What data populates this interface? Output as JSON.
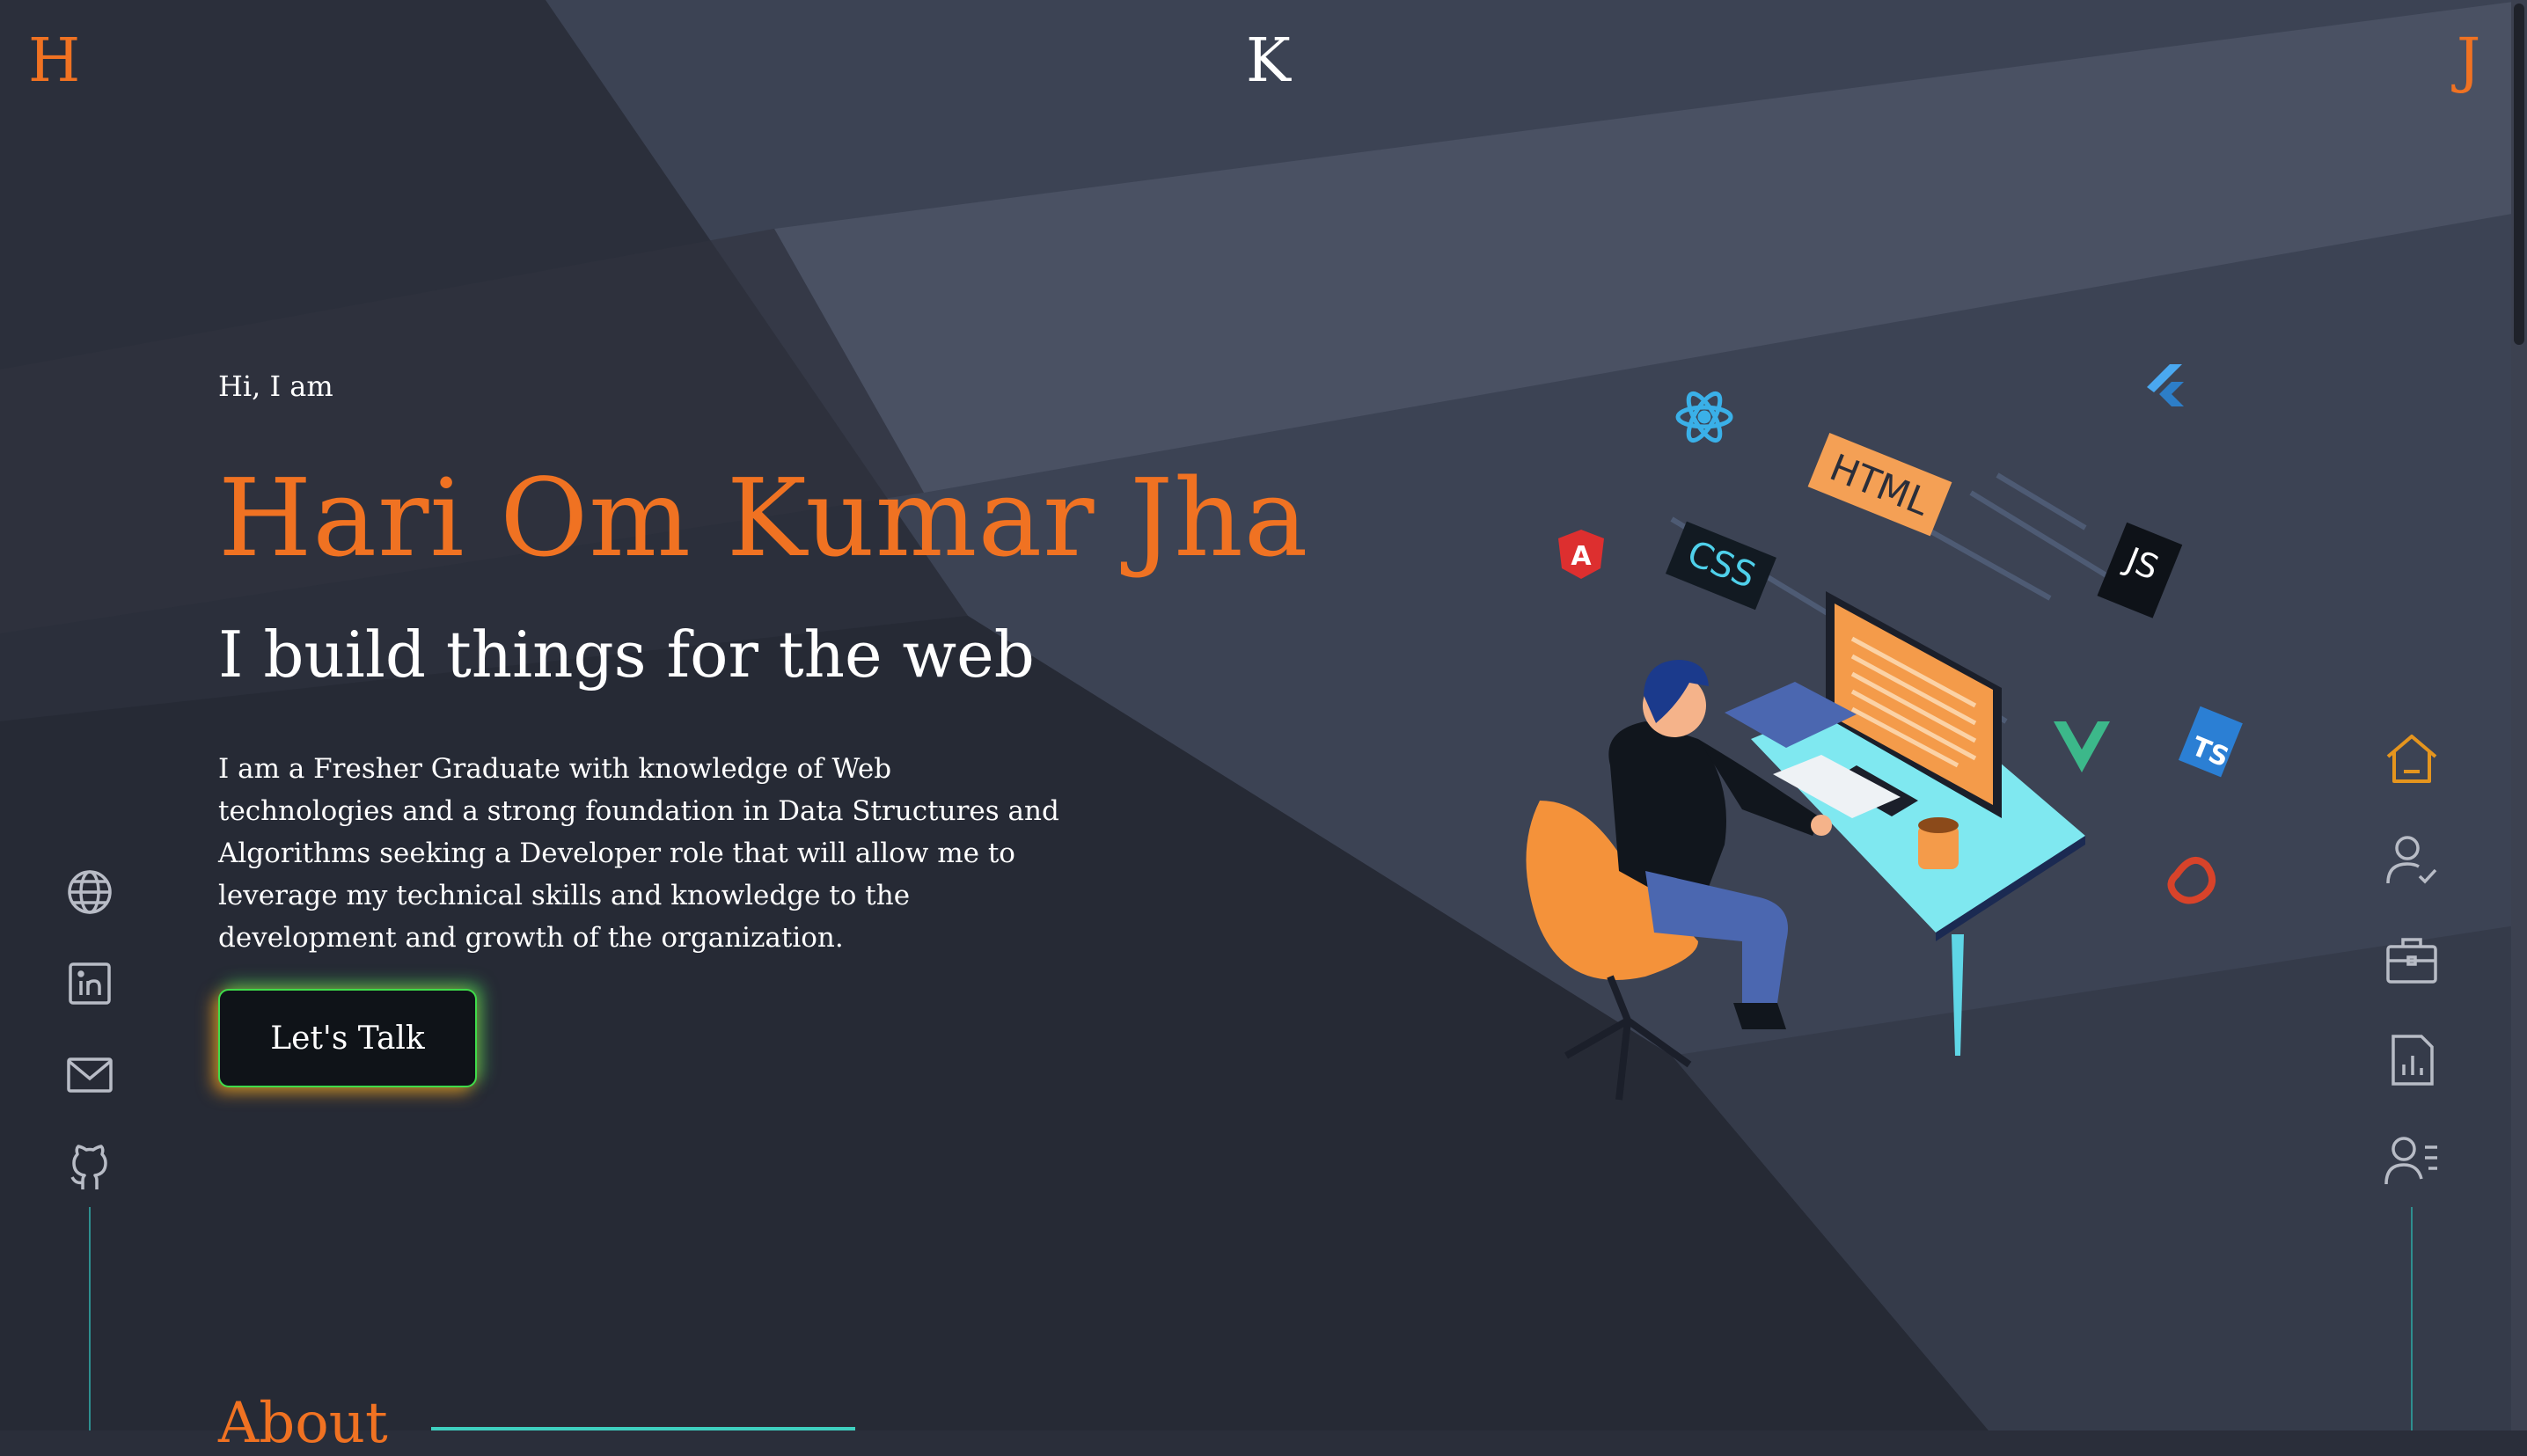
{
  "header": {
    "left_logo": "H",
    "center_logo": "K",
    "right_logo": "J"
  },
  "hero": {
    "greeting": "Hi, I am",
    "name": "Hari Om Kumar Jha",
    "tagline": "I build things for the web",
    "bio": "I am a Fresher Graduate with knowledge of Web technologies and a strong foundation in Data Structures and Algorithms seeking a Developer role that will allow me to leverage my technical skills and knowledge to the development and growth of the organization.",
    "cta_label": "Let's Talk"
  },
  "social_icons": [
    "globe-icon",
    "linkedin-icon",
    "mail-icon",
    "github-icon"
  ],
  "nav_icons": [
    "home-icon",
    "user-check-icon",
    "briefcase-icon",
    "report-icon",
    "contact-list-icon"
  ],
  "illustration": {
    "tags": [
      "HTML",
      "CSS",
      "JS",
      "TS",
      "A"
    ]
  },
  "section": {
    "about_title": "About"
  },
  "colors": {
    "accent": "#f07222",
    "background": "#2a2e3a",
    "nav_active": "#e5951e",
    "icon": "#b8bcc6",
    "teal": "#3fd0c0"
  }
}
